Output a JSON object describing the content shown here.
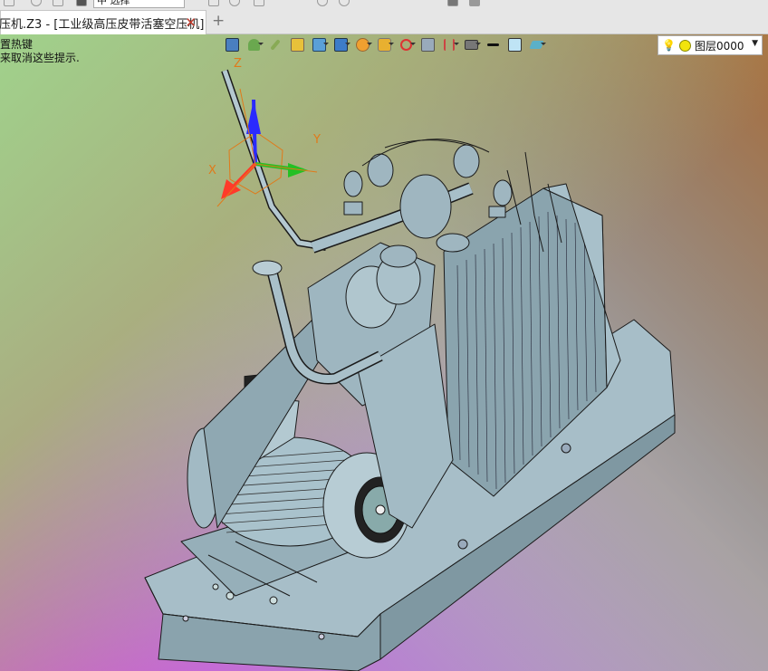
{
  "quick_access": {
    "selection_value": "中  选择"
  },
  "tab": {
    "title": "压机.Z3 - [工业级高压皮带活塞空压机]",
    "close_glyph": "✕",
    "new_tab_glyph": "+"
  },
  "hints": {
    "line1": "置热键",
    "line2": "来取消这些提示."
  },
  "view_toolbar": {
    "buttons": [
      "view-cube",
      "shading",
      "brush",
      "solid-box",
      "box",
      "view-box",
      "sphere",
      "render",
      "axis",
      "section",
      "clip",
      "display",
      "line-color",
      "fill-color",
      "layers-stack"
    ]
  },
  "layer": {
    "label": "图层0000"
  },
  "triad": {
    "x_label": "X",
    "y_label": "Y",
    "z_label": "Z"
  },
  "colors": {
    "triad_x": "#ff3a2a",
    "triad_y": "#24c024",
    "triad_z": "#2a2aff",
    "triad_labels": "#e07a1a",
    "model": "#9fb8c2",
    "model_edges": "#1a1a1a"
  }
}
